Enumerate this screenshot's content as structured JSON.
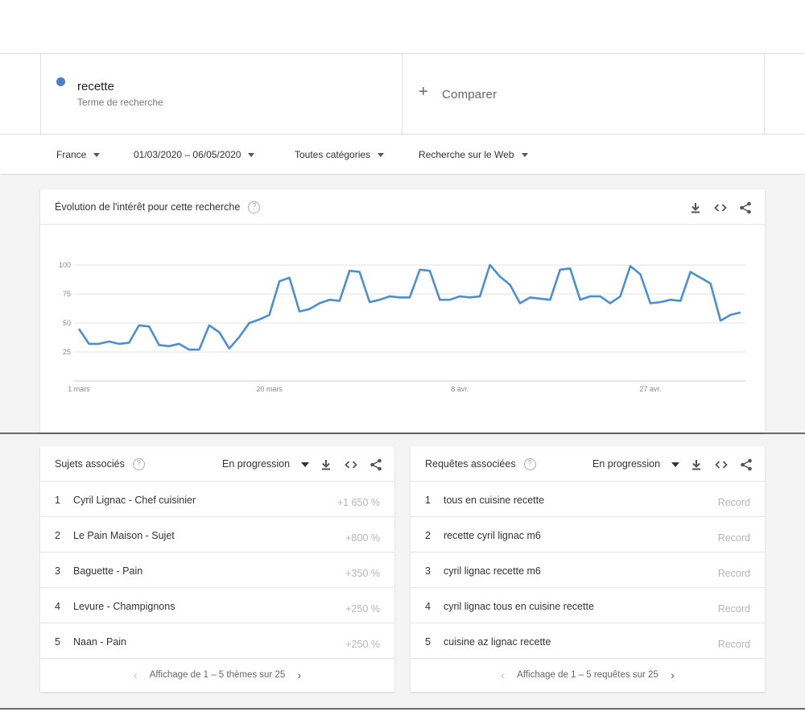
{
  "term": {
    "name": "recette",
    "subtitle": "Terme de recherche",
    "color": "#4f7ec4"
  },
  "compare": {
    "label": "Comparer"
  },
  "filters": [
    {
      "label": "France"
    },
    {
      "label": "01/03/2020 – 06/05/2020"
    },
    {
      "label": "Toutes catégories"
    },
    {
      "label": "Recherche sur le Web"
    }
  ],
  "interest": {
    "title": "Évolution de l'intérêt pour cette recherche",
    "help": "?"
  },
  "chart_data": {
    "type": "line",
    "title": "Évolution de l'intérêt pour cette recherche",
    "xlabel": "",
    "ylabel": "",
    "ylim": [
      0,
      100
    ],
    "yticks": [
      25,
      50,
      75,
      100
    ],
    "xtick_labels": [
      {
        "index": 0,
        "label": "1 mars"
      },
      {
        "index": 19,
        "label": "20 mars"
      },
      {
        "index": 38,
        "label": "8 avr."
      },
      {
        "index": 57,
        "label": "27 avr."
      }
    ],
    "grid": true,
    "color": "#4a90d0",
    "series": [
      {
        "values": [
          45,
          32,
          32,
          34,
          32,
          33,
          48,
          47,
          31,
          30,
          32,
          27,
          27,
          48,
          42,
          28,
          38,
          50,
          53,
          57,
          86,
          89,
          60,
          62,
          67,
          70,
          69,
          95,
          94,
          68,
          70,
          73,
          72,
          72,
          96,
          95,
          70,
          70,
          73,
          72,
          73,
          100,
          90,
          83,
          67,
          72,
          71,
          70,
          96,
          97,
          70,
          73,
          73,
          67,
          73,
          99,
          92,
          67,
          68,
          70,
          69,
          94,
          89,
          84,
          52,
          57,
          59
        ]
      }
    ]
  },
  "topics": {
    "title": "Sujets associés",
    "help": "?",
    "filter": "En progression",
    "rows": [
      {
        "num": "1",
        "label": "Cyril Lignac - Chef cuisinier",
        "value": "+1 650 %"
      },
      {
        "num": "2",
        "label": "Le Pain Maison - Sujet",
        "value": "+800 %"
      },
      {
        "num": "3",
        "label": "Baguette - Pain",
        "value": "+350 %"
      },
      {
        "num": "4",
        "label": "Levure - Champignons",
        "value": "+250 %"
      },
      {
        "num": "5",
        "label": "Naan - Pain",
        "value": "+250 %"
      }
    ],
    "pager": "Affichage de 1 – 5 thèmes sur 25"
  },
  "queries": {
    "title": "Requêtes associées",
    "help": "?",
    "filter": "En progression",
    "rows": [
      {
        "num": "1",
        "label": "tous en cuisine recette",
        "value": "Record"
      },
      {
        "num": "2",
        "label": "recette cyril lignac m6",
        "value": "Record"
      },
      {
        "num": "3",
        "label": "cyril lignac recette m6",
        "value": "Record"
      },
      {
        "num": "4",
        "label": "cyril lignac tous en cuisine recette",
        "value": "Record"
      },
      {
        "num": "5",
        "label": "cuisine az lignac recette",
        "value": "Record"
      }
    ],
    "pager": "Affichage de 1 – 5 requêtes sur 25"
  },
  "pager_arrows": {
    "prev": "‹",
    "next": "›"
  }
}
